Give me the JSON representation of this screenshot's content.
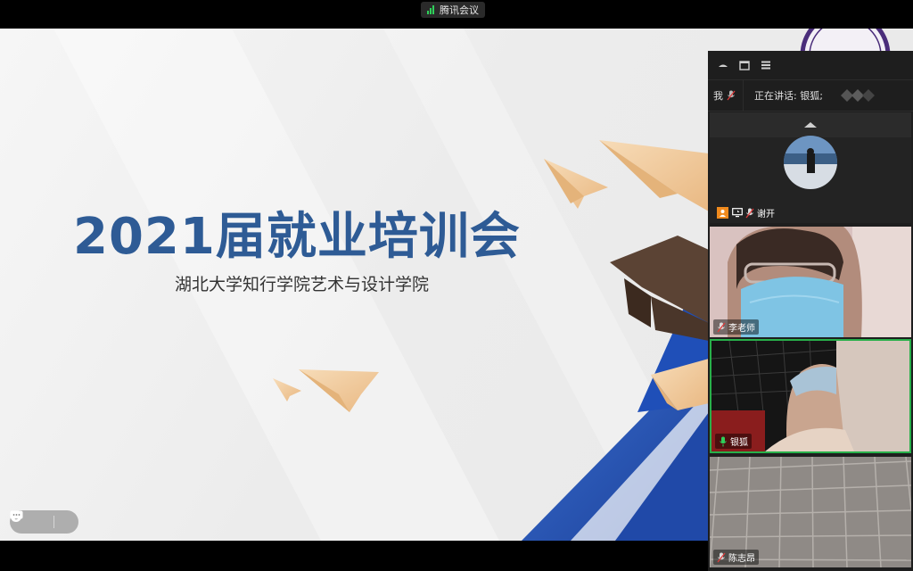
{
  "top_bar": {
    "app_name": "腾讯会议",
    "signal_color": "#2fd05a"
  },
  "slide": {
    "title": "2021届就业培训会",
    "subtitle": "湖北大学知行学院艺术与设计学院",
    "title_color": "#2e5b95",
    "reaction_icons": [
      "emoji-icon",
      "chat-bubble-icon",
      "chevron-left-icon"
    ]
  },
  "panel": {
    "toolbar_icons": [
      "minimize-icon",
      "window-icon",
      "list-layout-icon"
    ],
    "me_label": "我",
    "speaking_label": "正在讲话: 银狐;",
    "participants": [
      {
        "name": "谢开",
        "mic": "muted",
        "host": true,
        "sharing": true,
        "video": "avatar"
      },
      {
        "name": "李老师",
        "mic": "muted",
        "host": false,
        "sharing": false,
        "video": "camera"
      },
      {
        "name": "银狐",
        "mic": "active",
        "host": false,
        "sharing": false,
        "video": "camera",
        "speaking": true
      },
      {
        "name": "陈志昂",
        "mic": "muted",
        "host": false,
        "sharing": false,
        "video": "camera"
      }
    ],
    "mic_muted_color": "#e03a3a",
    "mic_active_color": "#2fd05a",
    "speaking_border_color": "#28b04a"
  }
}
